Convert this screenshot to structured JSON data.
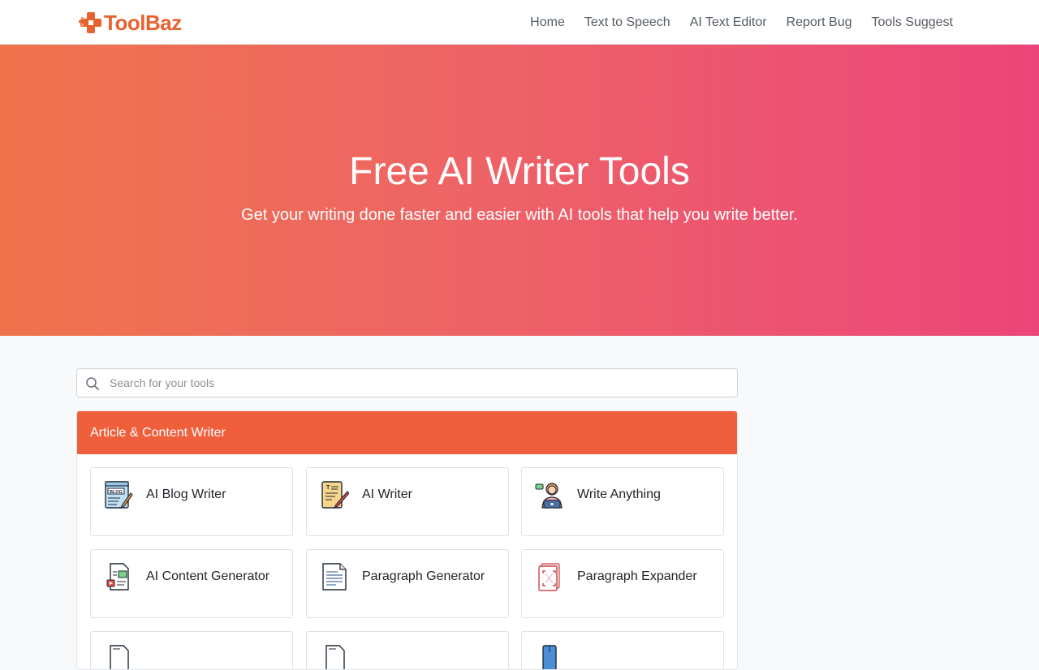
{
  "brand": {
    "part1": "Tool",
    "part2": "Baz"
  },
  "nav": [
    {
      "label": "Home"
    },
    {
      "label": "Text to Speech"
    },
    {
      "label": "AI Text Editor"
    },
    {
      "label": "Report Bug"
    },
    {
      "label": "Tools Suggest"
    }
  ],
  "hero": {
    "title": "Free AI Writer Tools",
    "subtitle": "Get your writing done faster and easier with AI tools that help you write better."
  },
  "search": {
    "placeholder": "Search for your tools",
    "value": ""
  },
  "section": {
    "title": "Article & Content Writer",
    "tools": [
      {
        "label": "AI Blog Writer",
        "icon": "blog-icon"
      },
      {
        "label": "AI Writer",
        "icon": "notepad-pen-icon"
      },
      {
        "label": "Write Anything",
        "icon": "person-laptop-icon"
      },
      {
        "label": "AI Content Generator",
        "icon": "document-media-icon"
      },
      {
        "label": "Paragraph Generator",
        "icon": "document-lines-icon"
      },
      {
        "label": "Paragraph Expander",
        "icon": "expand-document-icon"
      },
      {
        "label": "",
        "icon": "document-icon"
      },
      {
        "label": "",
        "icon": "document-icon"
      },
      {
        "label": "",
        "icon": "document-blue-icon"
      }
    ]
  },
  "colors": {
    "brand_orange": "#e8622f",
    "hero_gradient_start": "#ef744c",
    "hero_gradient_end": "#ec457a",
    "section_header": "#ef5f3c"
  }
}
